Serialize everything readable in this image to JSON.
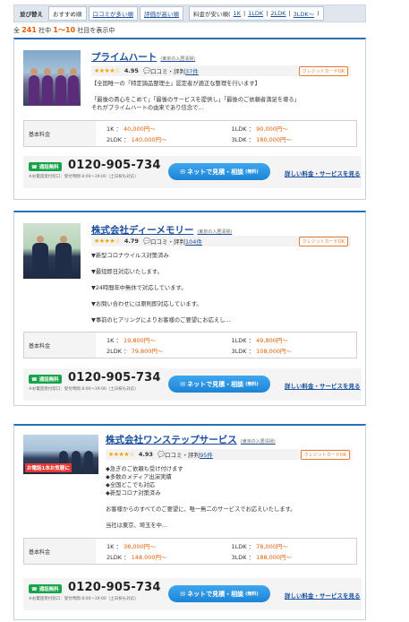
{
  "sort": {
    "label": "並び替え",
    "tabs": [
      "おすすめ順",
      "口コミが多い順",
      "評価が高い順"
    ],
    "price_label": "料金が安い順(",
    "price_links": [
      "1K",
      "1LDK",
      "2LDK",
      "3LDK〜"
    ],
    "price_close": ")"
  },
  "count": {
    "prefix": "全",
    "total": "241",
    "mid": "社中",
    "range": "1〜10",
    "suffix": "社目を表示中"
  },
  "cards": [
    {
      "name": "プライムハート",
      "area": "(東京の入居清掃)",
      "stars": "★★★★☆",
      "score": "4.95",
      "review_label": "口コミ・評判",
      "review_count": "37件",
      "credit": "クレジットカードOK",
      "desc": "【全国唯一の「特定調品整理士」認定者が適正な整理を行います】\n\n「最後の貴心をこめて」「最後のサービスを提供し」「最後のご依頼者満足を導る」\nそれがプライムハートの由来であり信念で...",
      "price_label": "基本料金",
      "prices": [
        {
          "k": "1K",
          "v": "40,000円〜"
        },
        {
          "k": "1LDK",
          "v": "90,000円〜"
        },
        {
          "k": "2LDK",
          "v": "140,000円〜"
        },
        {
          "k": "3LDK",
          "v": "180,000円〜"
        }
      ],
      "free_badge": "通話無料",
      "tel": "0120-905-734",
      "hours": "※お電話受付窓口：受付時間 8:00〜19:00（土日祝も対応）",
      "web_btn": "ネットで見積・相談",
      "web_btn_sub": "(無料)",
      "detail": "詳しい料金・サービスを見る"
    },
    {
      "name": "株式会社ディーメモリー",
      "area": "(東京の入居清掃)",
      "stars": "★★★★☆",
      "score": "4.79",
      "review_label": "口コミ・評判",
      "review_count": "104件",
      "credit": "クレジットカードOK",
      "desc": "▼新型コロナウイルス対策済み\n\n▼最短即日対応いたします。\n\n▼24時間年中無休で対応しています。\n\n▼お問い合わせには原則即対応しています。\n\n▼事前のヒアリングによりお客様のご要望にお応えし...",
      "price_label": "基本料金",
      "prices": [
        {
          "k": "1K",
          "v": "19,800円〜"
        },
        {
          "k": "1LDK",
          "v": "49,800円〜"
        },
        {
          "k": "2LDK",
          "v": "79,800円〜"
        },
        {
          "k": "3LDK",
          "v": "108,000円〜"
        }
      ],
      "free_badge": "通話無料",
      "tel": "0120-905-734",
      "hours": "※お電話受付窓口：受付時間 8:00〜19:00（土日祝も対応）",
      "web_btn": "ネットで見積・相談",
      "web_btn_sub": "(無料)",
      "detail": "詳しい料金・サービスを見る"
    },
    {
      "name": "株式会社ワンステップサービス",
      "area": "(東京の入居清掃)",
      "stars": "★★★★☆",
      "score": "4.93",
      "review_label": "口コミ・評判",
      "review_count": "95件",
      "credit": "クレジットカードOK",
      "photo_caption": "お電話1本お気軽に",
      "desc": "◆急ぎのご依頼も受け付けます\n◆多数のメディア出演実績\n◆全国どこでも対応\n◆新型コロナ対策済み\n\nお客様からのすべてのご要望に、唯一無二のサービスでお応えいたします。\n\n当社は東京、埼玉を中...",
      "price_label": "基本料金",
      "prices": [
        {
          "k": "1K",
          "v": "38,000円〜"
        },
        {
          "k": "1LDK",
          "v": "78,000円〜"
        },
        {
          "k": "2LDK",
          "v": "148,000円〜"
        },
        {
          "k": "3LDK",
          "v": "188,000円〜"
        }
      ],
      "free_badge": "通話無料",
      "tel": "0120-905-734",
      "hours": "※お電話受付窓口：受付時間 8:00〜19:00（土日祝も対応）",
      "web_btn": "ネットで見積・相談",
      "web_btn_sub": "(無料)",
      "detail": "詳しい料金・サービスを見る"
    }
  ]
}
